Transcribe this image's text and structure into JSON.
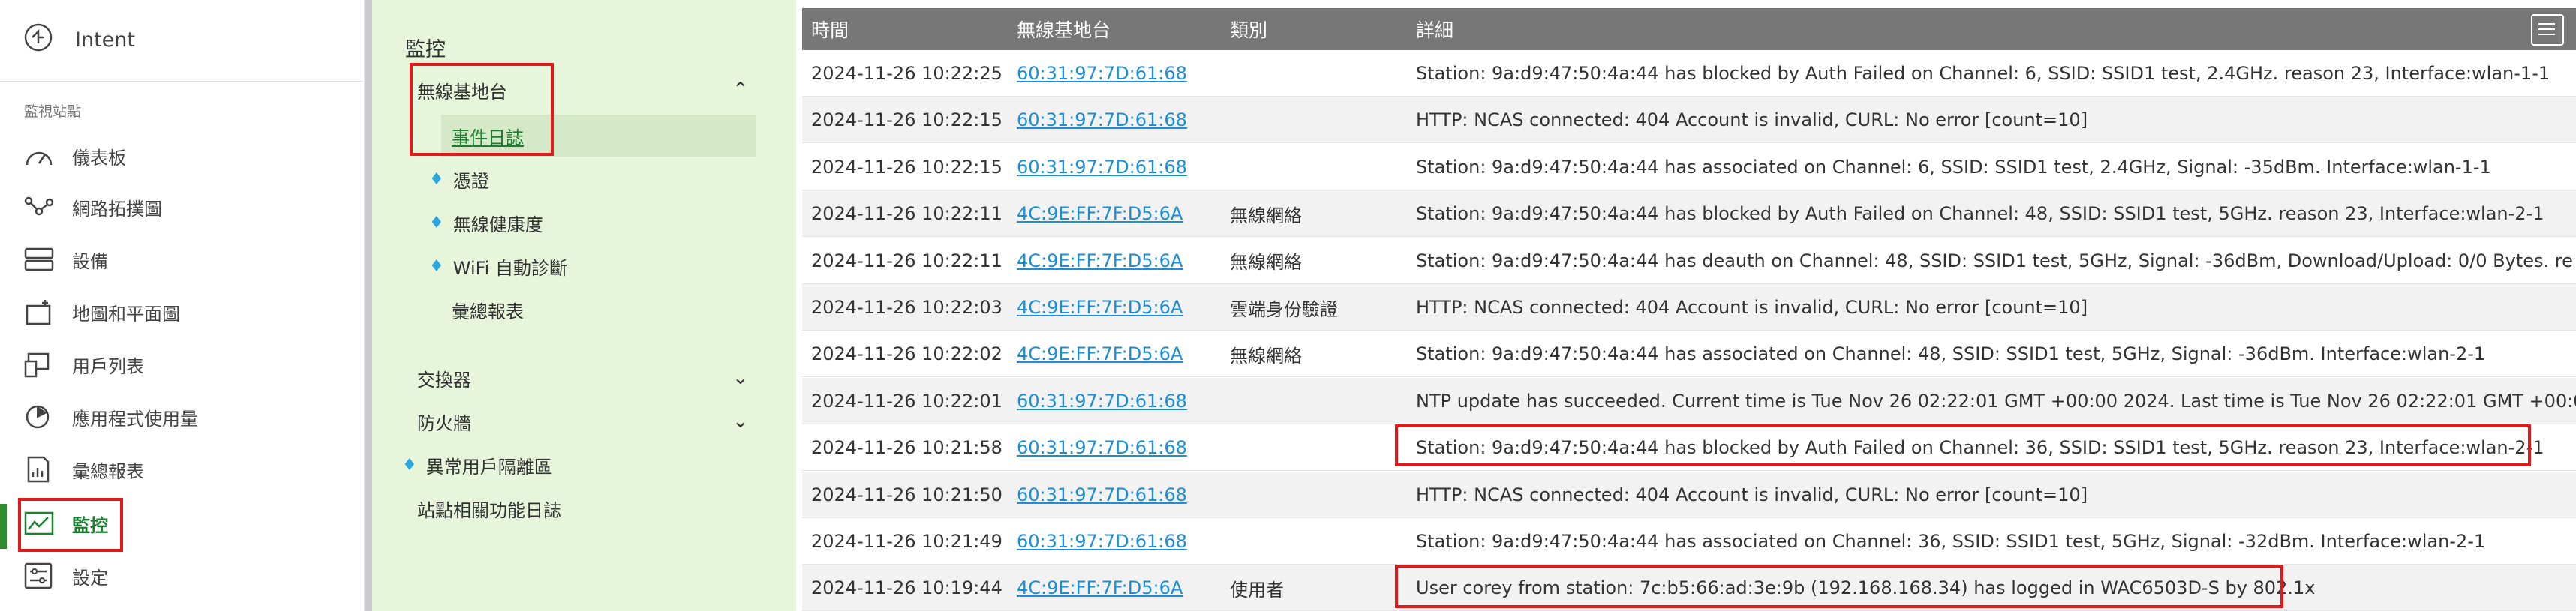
{
  "app": {
    "title": "Intent"
  },
  "nav": {
    "section_label": "監視站點",
    "items": [
      {
        "label": "儀表板",
        "icon": "dashboard-icon"
      },
      {
        "label": "網路拓撲圖",
        "icon": "topology-icon"
      },
      {
        "label": "設備",
        "icon": "devices-icon"
      },
      {
        "label": "地圖和平面圖",
        "icon": "map-icon"
      },
      {
        "label": "用戶列表",
        "icon": "clients-icon"
      },
      {
        "label": "應用程式使用量",
        "icon": "app-usage-icon"
      },
      {
        "label": "彙總報表",
        "icon": "report-icon"
      },
      {
        "label": "監控",
        "icon": "monitor-icon"
      },
      {
        "label": "設定",
        "icon": "settings-icon"
      }
    ]
  },
  "submenu": {
    "title": "監控",
    "wireless_ap": "無線基地台",
    "event_log": "事件日誌",
    "certificate": "憑證",
    "wireless_health": "無線健康度",
    "wifi_diag": "WiFi 自動診斷",
    "summary_report": "彙總報表",
    "switch": "交換器",
    "firewall": "防火牆",
    "abnormal_client": "異常用戶隔離區",
    "site_log": "站點相關功能日誌"
  },
  "table": {
    "headers": {
      "time": "時間",
      "ap": "無線基地台",
      "category": "類別",
      "detail": "詳細"
    },
    "rows": [
      {
        "time": "2024-11-26 10:22:25",
        "ap": "60:31:97:7D:61:68",
        "category": "",
        "detail": "Station: 9a:d9:47:50:4a:44 has blocked by Auth Failed on Channel: 6, SSID: SSID1 test, 2.4GHz. reason 23, Interface:wlan-1-1"
      },
      {
        "time": "2024-11-26 10:22:15",
        "ap": "60:31:97:7D:61:68",
        "category": "",
        "detail": "HTTP: NCAS connected: 404 Account is invalid, CURL: No error [count=10]"
      },
      {
        "time": "2024-11-26 10:22:15",
        "ap": "60:31:97:7D:61:68",
        "category": "",
        "detail": "Station: 9a:d9:47:50:4a:44 has associated on Channel: 6, SSID: SSID1 test, 2.4GHz, Signal: -35dBm. Interface:wlan-1-1"
      },
      {
        "time": "2024-11-26 10:22:11",
        "ap": "4C:9E:FF:7F:D5:6A",
        "category": "無線網絡",
        "detail": "Station: 9a:d9:47:50:4a:44 has blocked by Auth Failed on Channel: 48, SSID: SSID1 test, 5GHz. reason 23, Interface:wlan-2-1"
      },
      {
        "time": "2024-11-26 10:22:11",
        "ap": "4C:9E:FF:7F:D5:6A",
        "category": "無線網絡",
        "detail": "Station: 9a:d9:47:50:4a:44 has deauth on Channel: 48, SSID: SSID1 test, 5GHz, Signal: -36dBm, Download/Upload: 0/0 Bytes. re"
      },
      {
        "time": "2024-11-26 10:22:03",
        "ap": "4C:9E:FF:7F:D5:6A",
        "category": "雲端身份驗證",
        "detail": "HTTP: NCAS connected: 404 Account is invalid, CURL: No error [count=10]"
      },
      {
        "time": "2024-11-26 10:22:02",
        "ap": "4C:9E:FF:7F:D5:6A",
        "category": "無線網絡",
        "detail": "Station: 9a:d9:47:50:4a:44 has associated on Channel: 48, SSID: SSID1 test, 5GHz, Signal: -36dBm. Interface:wlan-2-1"
      },
      {
        "time": "2024-11-26 10:22:01",
        "ap": "60:31:97:7D:61:68",
        "category": "",
        "detail": "NTP update has succeeded. Current time is Tue Nov 26 02:22:01 GMT +00:00 2024. Last time is Tue Nov 26 02:22:01 GMT +00:0"
      },
      {
        "time": "2024-11-26 10:21:58",
        "ap": "60:31:97:7D:61:68",
        "category": "",
        "detail": "Station: 9a:d9:47:50:4a:44 has blocked by Auth Failed on Channel: 36, SSID: SSID1 test, 5GHz. reason 23, Interface:wlan-2-1"
      },
      {
        "time": "2024-11-26 10:21:50",
        "ap": "60:31:97:7D:61:68",
        "category": "",
        "detail": "HTTP: NCAS connected: 404 Account is invalid, CURL: No error [count=10]"
      },
      {
        "time": "2024-11-26 10:21:49",
        "ap": "60:31:97:7D:61:68",
        "category": "",
        "detail": "Station: 9a:d9:47:50:4a:44 has associated on Channel: 36, SSID: SSID1 test, 5GHz, Signal: -32dBm. Interface:wlan-2-1"
      },
      {
        "time": "2024-11-26 10:19:44",
        "ap": "4C:9E:FF:7F:D5:6A",
        "category": "使用者",
        "detail": "User corey from station: 7c:b5:66:ad:3e:9b (192.168.168.34) has logged in WAC6503D-S by 802.1x"
      }
    ]
  },
  "colors": {
    "accent": "#1a7f2e",
    "highlight": "#e01a1a",
    "link": "#1a8fd8",
    "header": "#777777",
    "submenu_bg": "#e7f5db"
  }
}
